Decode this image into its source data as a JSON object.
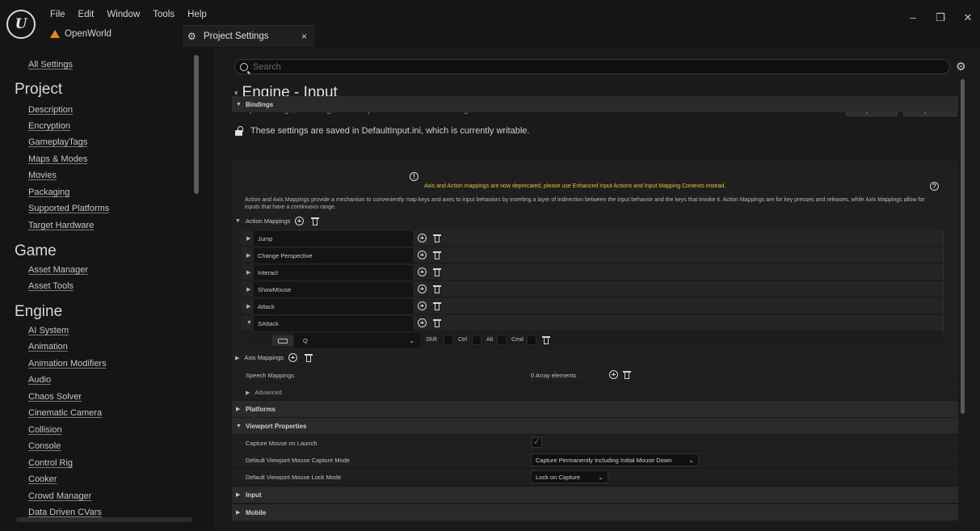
{
  "app": {
    "logo": "U",
    "menu": [
      "File",
      "Edit",
      "Window",
      "Tools",
      "Help"
    ],
    "project_name": "OpenWorld",
    "tab_title": "Project Settings",
    "tab_close": "×",
    "window_controls": {
      "minimize": "–",
      "restore": "❐",
      "close": "✕"
    }
  },
  "sidebar": {
    "all_settings": "All Settings",
    "groups": [
      {
        "title": "Project",
        "items": [
          "Description",
          "Encryption",
          "GameplayTags",
          "Maps & Modes",
          "Movies",
          "Packaging",
          "Supported Platforms",
          "Target Hardware"
        ]
      },
      {
        "title": "Game",
        "items": [
          "Asset Manager",
          "Asset Tools"
        ]
      },
      {
        "title": "Engine",
        "items": [
          "AI System",
          "Animation",
          "Animation Modifiers",
          "Audio",
          "Chaos Solver",
          "Cinematic Camera",
          "Collision",
          "Console",
          "Control Rig",
          "Cooker",
          "Crowd Manager",
          "Data Driven CVars"
        ]
      }
    ]
  },
  "search": {
    "placeholder": "Search"
  },
  "section": {
    "caret": "▾",
    "title": "Engine - Input",
    "description": "Input settings, including default input action and axis bindings.",
    "export_label": "Export...",
    "import_label": "Import...",
    "save_note": "These settings are saved in DefaultInput.ini, which is currently writable."
  },
  "bindings": {
    "title": "Bindings",
    "warning": "Axis and Action mappings are now deprecated, please use Enhanced Input Actions and Input Mapping Contexts instead.",
    "description": "Action and Axis Mappings provide a mechanism to conveniently map keys and axes to input behaviors by inserting a layer of indirection between the input behavior and the keys that invoke it. Action Mappings are for key presses and releases, while Axis Mappings allow for inputs that have a continuous range.",
    "action_mappings_label": "Action Mappings",
    "actions": [
      "Jump",
      "Change Perspective",
      "Interact",
      "ShowMouse",
      "Attack",
      "SAttack"
    ],
    "expanded_key": {
      "key": "Q",
      "modifiers": [
        "Shift",
        "Ctrl",
        "Alt",
        "Cmd"
      ]
    },
    "axis_mappings_label": "Axis Mappings",
    "speech_mappings_label": "Speech Mappings",
    "speech_mappings_value": "0 Array elements",
    "advanced_label": "Advanced"
  },
  "platforms": {
    "title": "Platforms"
  },
  "viewport": {
    "title": "Viewport Properties",
    "capture_mouse_label": "Capture Mouse on Launch",
    "capture_mouse_checked": "✓",
    "capture_mode_label": "Default Viewport Mouse Capture Mode",
    "capture_mode_value": "Capture Permanently Including Initial Mouse Down",
    "lock_mode_label": "Default Viewport Mouse Lock Mode",
    "lock_mode_value": "Lock on Capture"
  },
  "input_category": {
    "title": "Input"
  },
  "mobile_category": {
    "title": "Mobile"
  },
  "icons": {
    "gear": "⚙",
    "chevron_down": "⌄",
    "caret_right": "▶",
    "caret_down": "▼"
  }
}
